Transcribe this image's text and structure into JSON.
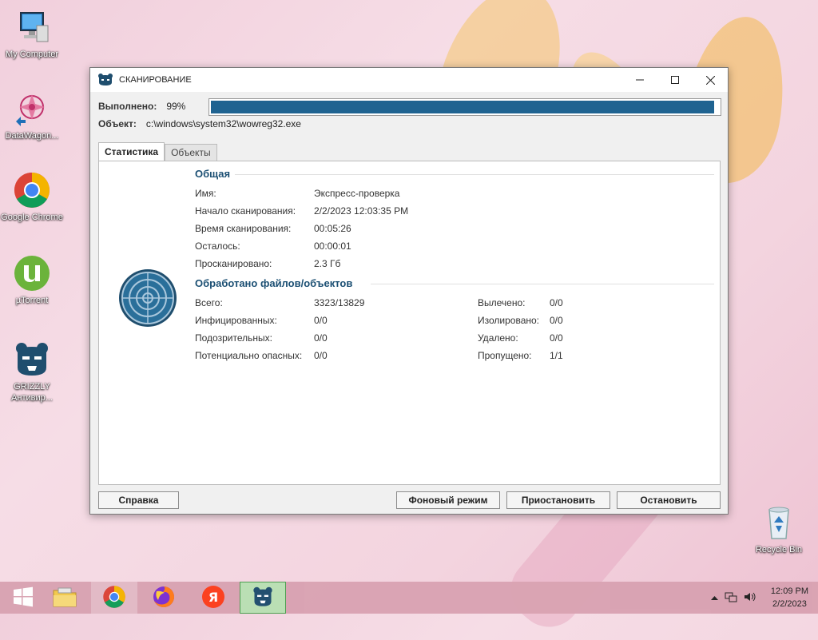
{
  "desktop": {
    "icons": [
      {
        "label": "My Computer",
        "icon": "computer-icon"
      },
      {
        "label": "DataWagon...",
        "icon": "datawagon-icon"
      },
      {
        "label": "Google Chrome",
        "icon": "chrome-icon"
      },
      {
        "label": "µTorrent",
        "icon": "utorrent-icon"
      },
      {
        "label": "GRIZZLY Антивир...",
        "icon": "grizzly-icon"
      },
      {
        "label": "Recycle Bin",
        "icon": "recycle-bin-icon"
      }
    ]
  },
  "window": {
    "title": "СКАНИРОВАНИЕ",
    "progress": {
      "label": "Выполнено:",
      "value_text": "99%",
      "value": 0.99
    },
    "object": {
      "label": "Объект:",
      "path": "c:\\windows\\system32\\wowreg32.exe"
    },
    "tabs": [
      "Статистика",
      "Объекты"
    ],
    "general": {
      "title": "Общая",
      "rows": [
        {
          "label": "Имя:",
          "value": "Экспресс-проверка"
        },
        {
          "label": "Начало сканирования:",
          "value": "2/2/2023 12:03:35 PM"
        },
        {
          "label": "Время сканирования:",
          "value": "00:05:26"
        },
        {
          "label": "Осталось:",
          "value": "00:00:01"
        },
        {
          "label": "Просканировано:",
          "value": "2.3 Гб"
        }
      ]
    },
    "processed": {
      "title": "Обработано файлов/объектов",
      "left": [
        {
          "label": "Всего:",
          "value": "3323/13829"
        },
        {
          "label": "Инфицированных:",
          "value": "0/0"
        },
        {
          "label": "Подозрительных:",
          "value": "0/0"
        },
        {
          "label": "Потенциально опасных:",
          "value": "0/0"
        }
      ],
      "right": [
        {
          "label": "Вылечено:",
          "value": "0/0"
        },
        {
          "label": "Изолировано:",
          "value": "0/0"
        },
        {
          "label": "Удалено:",
          "value": "0/0"
        },
        {
          "label": "Пропущено:",
          "value": "1/1"
        }
      ]
    },
    "buttons": {
      "help": "Справка",
      "background": "Фоновый режим",
      "pause": "Приостановить",
      "stop": "Остановить"
    }
  },
  "taskbar": {
    "items": [
      "start-icon",
      "file-explorer-icon",
      "chrome-icon",
      "firefox-icon",
      "yandex-icon",
      "grizzly-icon"
    ],
    "clock": {
      "time": "12:09 PM",
      "date": "2/2/2023"
    }
  },
  "colors": {
    "accent": "#1f6391",
    "section": "#1b4f73"
  }
}
